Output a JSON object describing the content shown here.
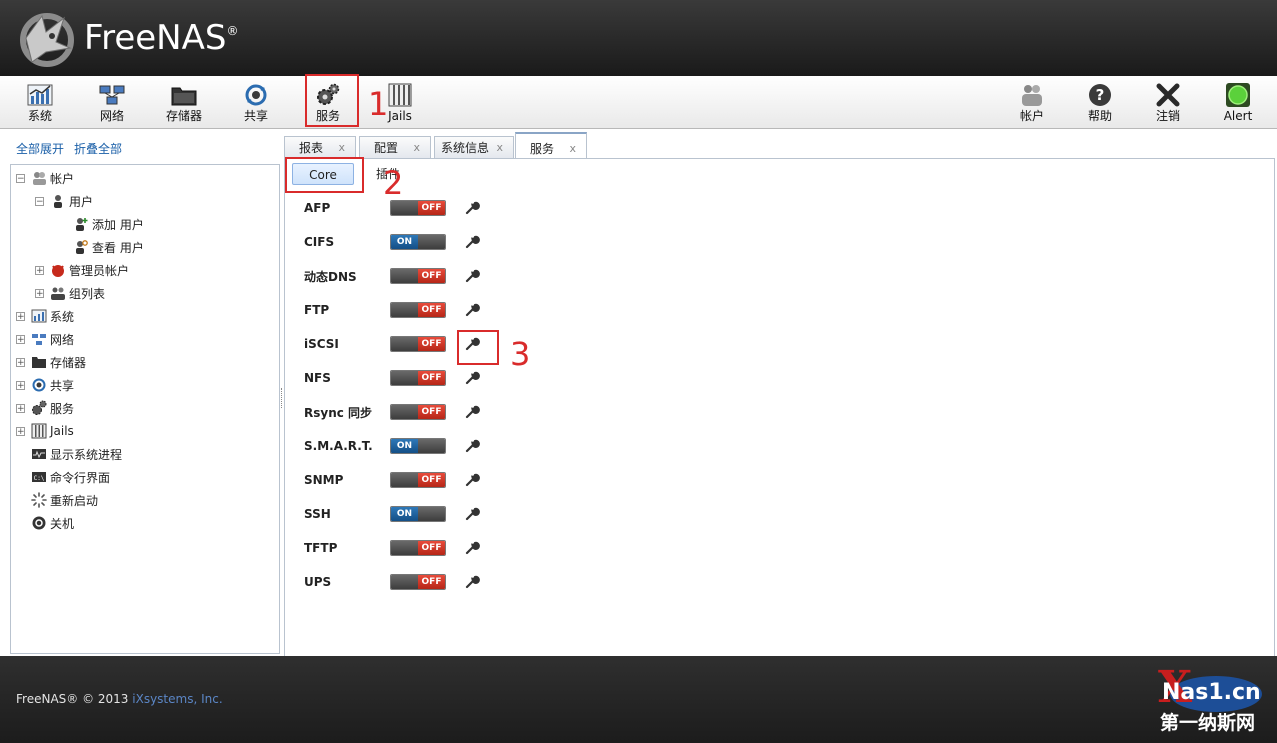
{
  "header": {
    "brand": "FreeNAS",
    "brand_mark": "®"
  },
  "toolbar": {
    "left": [
      {
        "label": "系统",
        "icon": "system-chart-icon"
      },
      {
        "label": "网络",
        "icon": "network-icon"
      },
      {
        "label": "存储器",
        "icon": "storage-icon"
      },
      {
        "label": "共享",
        "icon": "sharing-icon"
      },
      {
        "label": "服务",
        "icon": "services-gear-icon"
      },
      {
        "label": "Jails",
        "icon": "jails-bars-icon"
      }
    ],
    "right": [
      {
        "label": "帐户",
        "icon": "account-icon"
      },
      {
        "label": "帮助",
        "icon": "help-icon"
      },
      {
        "label": "注销",
        "icon": "logout-x-icon"
      },
      {
        "label": "Alert",
        "icon": "alert-light-icon"
      }
    ]
  },
  "annotations": {
    "n1": "1",
    "n2": "2",
    "n3": "3"
  },
  "sidebar": {
    "expand_all": "全部展开",
    "collapse_all": "折叠全部",
    "tree": [
      {
        "label": "帐户",
        "toggle": "−"
      },
      {
        "label": "用户",
        "toggle": "−"
      },
      {
        "label": "添加 用户"
      },
      {
        "label": "查看 用户"
      },
      {
        "label": "管理员帐户",
        "toggle": "+"
      },
      {
        "label": "组列表",
        "toggle": "+"
      },
      {
        "label": "系统",
        "toggle": "+"
      },
      {
        "label": "网络",
        "toggle": "+"
      },
      {
        "label": "存储器",
        "toggle": "+"
      },
      {
        "label": "共享",
        "toggle": "+"
      },
      {
        "label": "服务",
        "toggle": "+"
      },
      {
        "label": "Jails",
        "toggle": "+"
      },
      {
        "label": "显示系统进程"
      },
      {
        "label": "命令行界面"
      },
      {
        "label": "重新启动"
      },
      {
        "label": "关机"
      }
    ]
  },
  "tabs": [
    {
      "label": "报表",
      "close": "x"
    },
    {
      "label": "配置",
      "close": "x"
    },
    {
      "label": "系统信息",
      "close": "x"
    },
    {
      "label": "服务",
      "close": "x"
    }
  ],
  "subtabs": [
    "Core",
    "插件"
  ],
  "services": [
    {
      "name": "AFP",
      "state": "OFF"
    },
    {
      "name": "CIFS",
      "state": "ON"
    },
    {
      "name": "动态DNS",
      "state": "OFF"
    },
    {
      "name": "FTP",
      "state": "OFF"
    },
    {
      "name": "iSCSI",
      "state": "OFF"
    },
    {
      "name": "NFS",
      "state": "OFF"
    },
    {
      "name": "Rsync 同步",
      "state": "OFF"
    },
    {
      "name": "S.M.A.R.T.",
      "state": "ON"
    },
    {
      "name": "SNMP",
      "state": "OFF"
    },
    {
      "name": "SSH",
      "state": "ON"
    },
    {
      "name": "TFTP",
      "state": "OFF"
    },
    {
      "name": "UPS",
      "state": "OFF"
    }
  ],
  "footer": {
    "copyright": "FreeNAS® © 2013",
    "company": "iXsystems, Inc.",
    "watermark_top": "Nas1.cn",
    "watermark_bottom": "第一纳斯网"
  },
  "colors": {
    "off": "#d0352a",
    "on": "#1d5f9c",
    "annotation": "#d92b2b"
  }
}
